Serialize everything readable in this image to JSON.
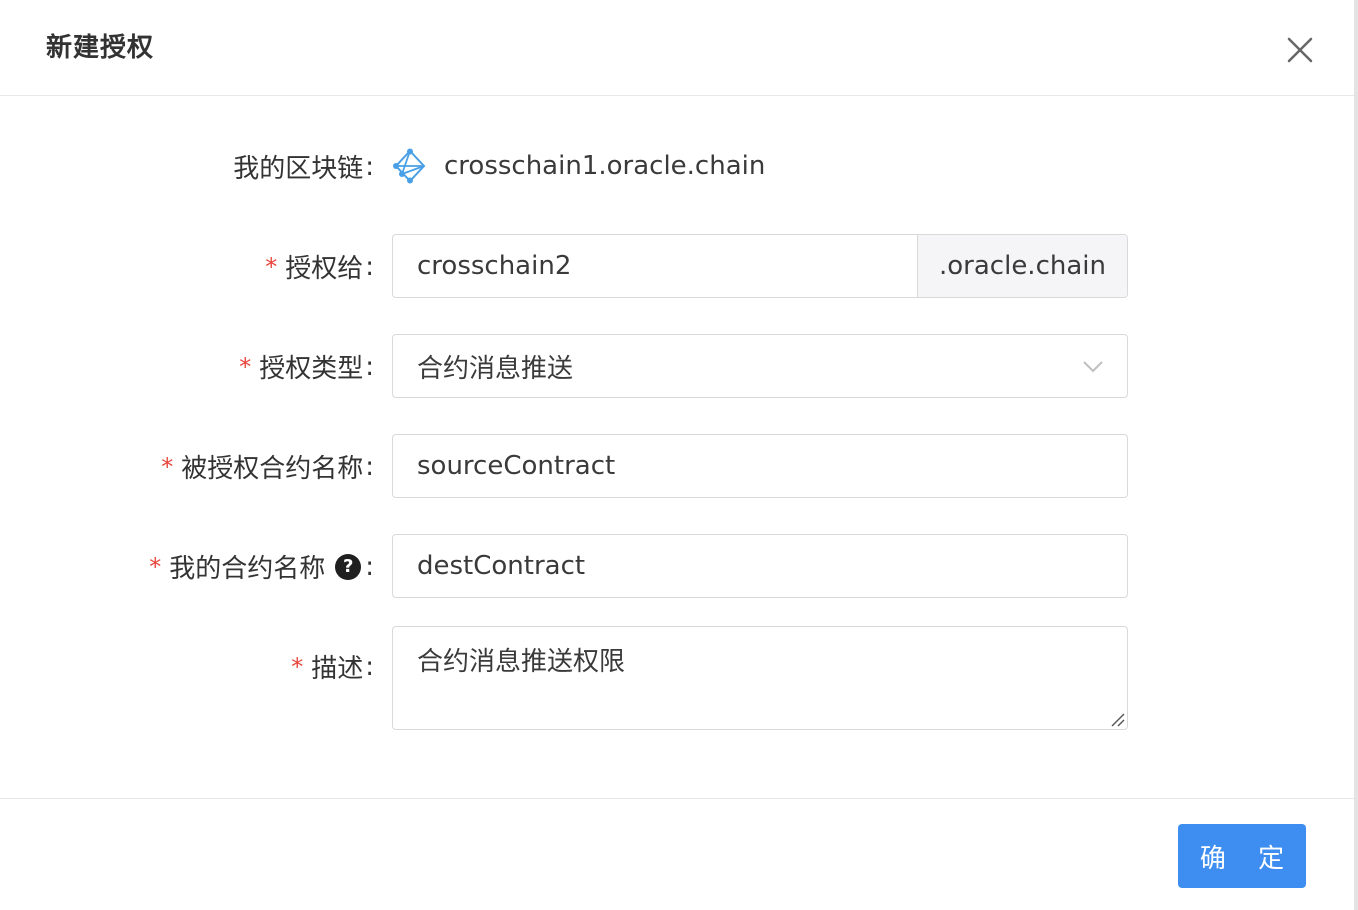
{
  "dialog": {
    "title": "新建授权",
    "confirm_label": "确 定"
  },
  "form": {
    "my_chain": {
      "label": "我的区块链",
      "value": "crosschain1.oracle.chain",
      "icon": "chain-network-icon"
    },
    "grant_to": {
      "label": "授权给",
      "value": "crosschain2",
      "suffix": ".oracle.chain",
      "required": true
    },
    "auth_type": {
      "label": "授权类型",
      "value": "合约消息推送",
      "required": true
    },
    "granted_contract": {
      "label": "被授权合约名称",
      "value": "sourceContract",
      "required": true
    },
    "my_contract": {
      "label": "我的合约名称",
      "value": "destContract",
      "required": true,
      "help": "?"
    },
    "description": {
      "label": "描述",
      "value": "合约消息推送权限",
      "required": true
    },
    "required_mark": "*",
    "colon": ":"
  },
  "colors": {
    "primary": "#3d8ef0",
    "required": "#e8453c"
  }
}
